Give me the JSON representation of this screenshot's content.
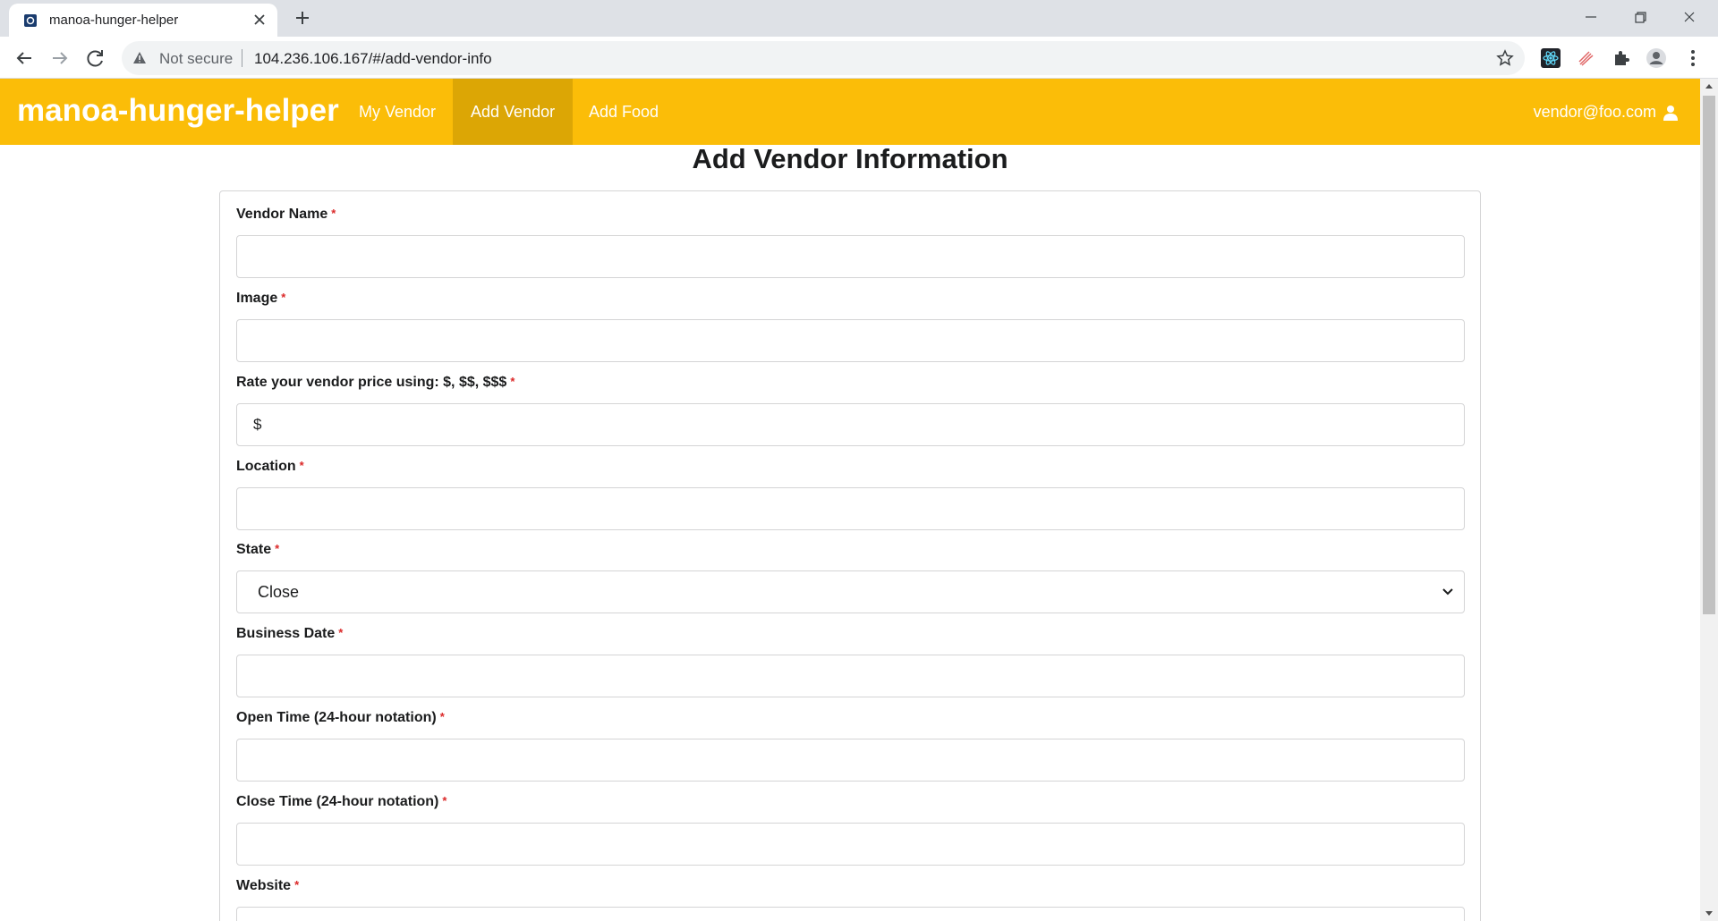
{
  "browser": {
    "tab_title": "manoa-hunger-helper",
    "security_label": "Not secure",
    "url": "104.236.106.167/#/add-vendor-info"
  },
  "navbar": {
    "brand": "manoa-hunger-helper",
    "links": [
      "My Vendor",
      "Add Vendor",
      "Add Food"
    ],
    "active_link": "Add Vendor",
    "user_email": "vendor@foo.com",
    "bg_color": "#fbbd08",
    "active_bg_color": "#dca605"
  },
  "page": {
    "title": "Add Vendor Information"
  },
  "form": {
    "required_marker": "*",
    "fields": [
      {
        "label": "Vendor Name",
        "value": ""
      },
      {
        "label": "Image",
        "value": ""
      },
      {
        "label": "Rate your vendor price using: $, $$, $$$",
        "value": "$"
      },
      {
        "label": "Location",
        "value": ""
      },
      {
        "label": "State",
        "value": "Close"
      },
      {
        "label": "Business Date",
        "value": ""
      },
      {
        "label": "Open Time (24-hour notation)",
        "value": ""
      },
      {
        "label": "Close Time (24-hour notation)",
        "value": ""
      },
      {
        "label": "Website",
        "value": ""
      }
    ]
  }
}
